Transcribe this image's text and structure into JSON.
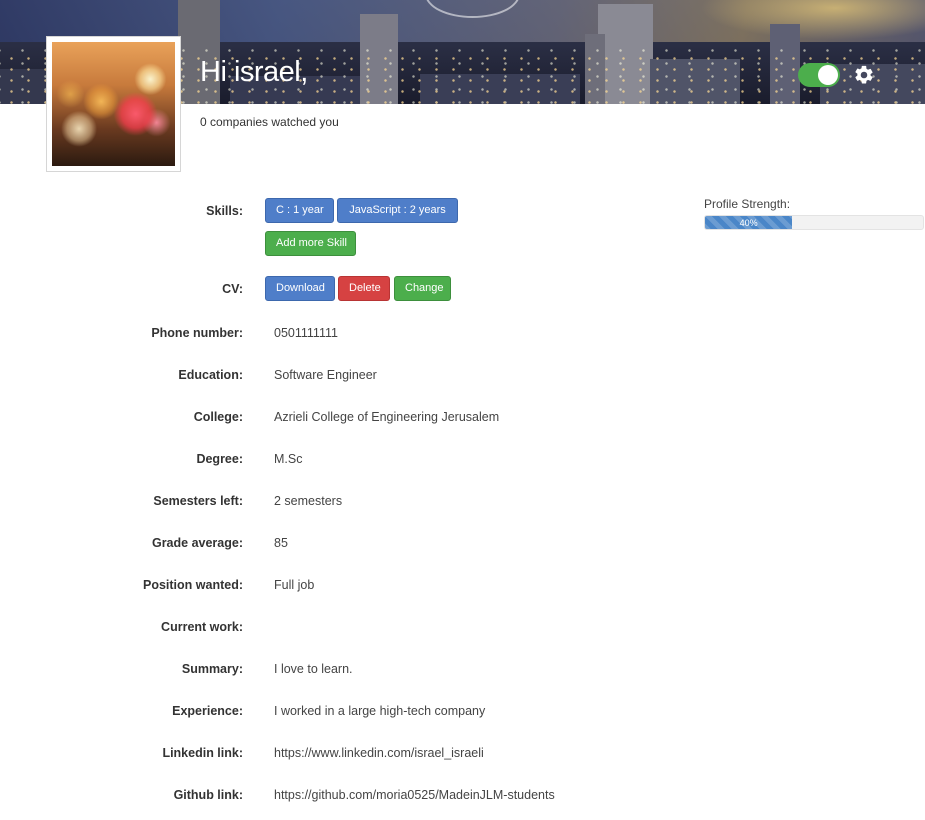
{
  "header": {
    "greeting": "Hi israel,",
    "watched_text": "0 companies watched you",
    "toggle_on": true,
    "accent_green": "#4cae4c"
  },
  "avatar": {
    "alt": "profile photo"
  },
  "profile_strength": {
    "label": "Profile Strength:",
    "percent": 40,
    "percent_text": "40%"
  },
  "skills": {
    "label": "Skills:",
    "items": [
      "C : 1 year",
      "JavaScript : 2 years"
    ],
    "add_label": "Add more Skill"
  },
  "cv": {
    "label": "CV:",
    "download_label": "Download",
    "delete_label": "Delete",
    "change_label": "Change"
  },
  "fields": [
    {
      "label": "Phone number:",
      "value": "0501111111"
    },
    {
      "label": "Education:",
      "value": "Software Engineer"
    },
    {
      "label": "College:",
      "value": "Azrieli College of Engineering Jerusalem"
    },
    {
      "label": "Degree:",
      "value": "M.Sc"
    },
    {
      "label": "Semesters left:",
      "value": "2 semesters"
    },
    {
      "label": "Grade average:",
      "value": "85"
    },
    {
      "label": "Position wanted:",
      "value": "Full job"
    },
    {
      "label": "Current work:",
      "value": ""
    },
    {
      "label": "Summary:",
      "value": "I love to learn."
    },
    {
      "label": "Experience:",
      "value": "I worked in a large high-tech company"
    },
    {
      "label": "Linkedin link:",
      "value": "https://www.linkedin.com/israel_israeli"
    },
    {
      "label": "Github link:",
      "value": "https://github.com/moria0525/MadeinJLM-students"
    }
  ]
}
